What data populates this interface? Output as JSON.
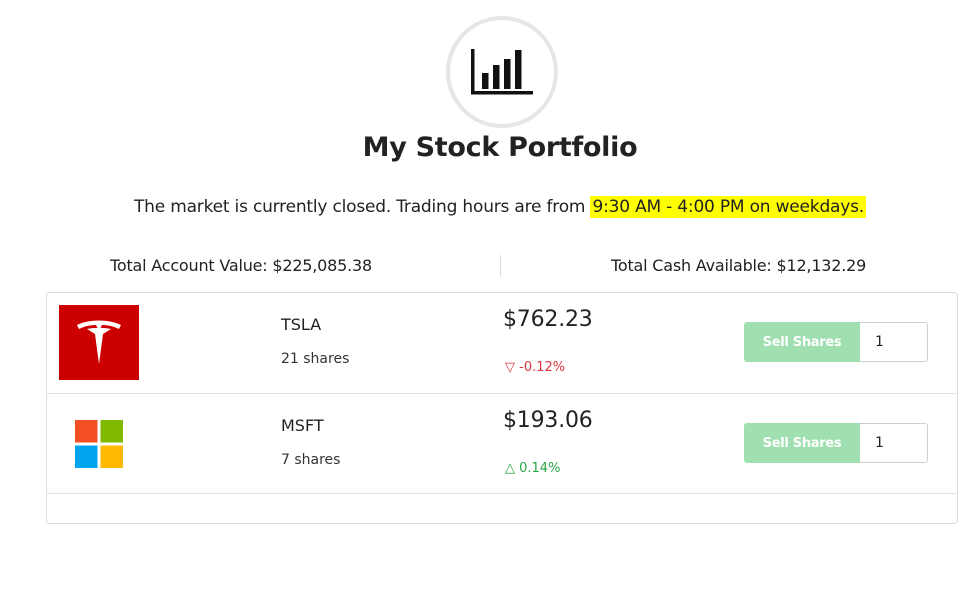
{
  "header": {
    "logo_icon": "bar-chart-icon",
    "title": "My Stock Portfolio"
  },
  "market": {
    "message": "The market is currently closed. Trading hours are from ",
    "hours": "9:30 AM - 4:00 PM on weekdays.",
    "highlight_color": "#ffff00"
  },
  "totals": {
    "account_value": "Total Account Value: $225,085.38",
    "cash_available": "Total Cash Available: $12,132.29"
  },
  "holdings": [
    {
      "logo_icon": "tesla-logo-icon",
      "logo_color": "#cc0000",
      "ticker": "TSLA",
      "shares": "21 shares",
      "price": "$762.23",
      "change": "▽ -0.12%",
      "change_direction": "down",
      "sell_label": "Sell Shares",
      "quantity": "1"
    },
    {
      "logo_icon": "microsoft-logo-icon",
      "ticker": "MSFT",
      "shares": "7 shares",
      "price": "$193.06",
      "change": "△ 0.14%",
      "change_direction": "up",
      "sell_label": "Sell Shares",
      "quantity": "1"
    }
  ],
  "colors": {
    "sell_button": "#9fdfb0",
    "negative": "#d9363e",
    "positive": "#28a745"
  }
}
